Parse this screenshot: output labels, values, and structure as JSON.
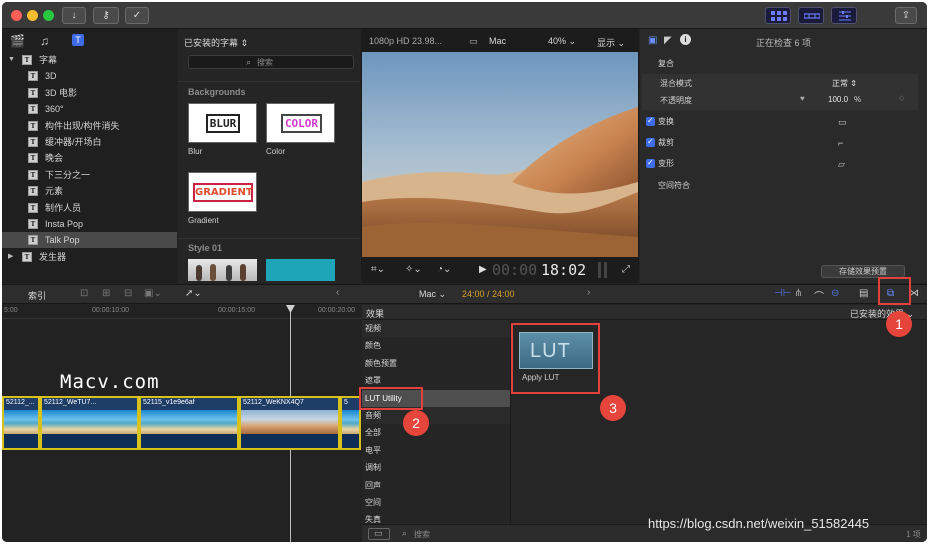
{
  "toolbar": {
    "import_icon": "download-arrow-icon",
    "keywords_icon": "key-icon",
    "analysis_icon": "checkmark-circle-icon",
    "share_icon": "share-icon"
  },
  "sidebar": {
    "items": [
      {
        "label": "字幕",
        "level": 0,
        "expanded": true
      },
      {
        "label": "3D",
        "level": 1
      },
      {
        "label": "3D 电影",
        "level": 1
      },
      {
        "label": "360°",
        "level": 1
      },
      {
        "label": "构件出现/构件消失",
        "level": 1
      },
      {
        "label": "缓冲器/开场白",
        "level": 1
      },
      {
        "label": "晚会",
        "level": 1
      },
      {
        "label": "下三分之一",
        "level": 1
      },
      {
        "label": "元素",
        "level": 1
      },
      {
        "label": "制作人员",
        "level": 1
      },
      {
        "label": "Insta Pop",
        "level": 1
      },
      {
        "label": "Talk Pop",
        "level": 1,
        "selected": true
      },
      {
        "label": "发生器",
        "level": 0,
        "expanded": false
      }
    ]
  },
  "browser": {
    "dropdown": "已安装的字幕 ⇕",
    "search_placeholder": "搜索",
    "section1": "Backgrounds",
    "thumbs": [
      {
        "text": "BLUR",
        "label": "Blur"
      },
      {
        "text": "COLOR",
        "label": "Color"
      },
      {
        "text": "GRADIENT",
        "label": "Gradient"
      }
    ],
    "section2": "Style 01"
  },
  "viewer": {
    "format": "1080p HD 23.98...",
    "project": "Mac",
    "zoom": "40% ⌄",
    "display": "显示 ⌄",
    "timecode_dim": "00:00",
    "timecode": "18:02"
  },
  "inspector": {
    "status": "正在检查 6 项",
    "composite": "复合",
    "blend_label": "混合模式",
    "blend_value": "正常 ⇕",
    "opacity_label": "不透明度",
    "opacity_value": "100.0",
    "opacity_unit": "%",
    "transform": "变换",
    "crop": "裁剪",
    "distort": "变形",
    "spatial": "空间符合",
    "save_preset": "存储效果预置"
  },
  "timeline_bar": {
    "index": "索引",
    "project": "Mac ⌄",
    "duration": "24:00 / 24:00"
  },
  "timeline": {
    "ruler": [
      "5:00",
      "00:00:10:00",
      "00:00:15:00",
      "00:00:20:00"
    ],
    "clips": [
      "52112_...",
      "52112_WeTU7...",
      "52115_v1e9e6af",
      "52112_WeKNX4Q7",
      "5"
    ]
  },
  "effects": {
    "title": "效果",
    "installed": "已安装的效果 ⌄",
    "categories": [
      {
        "label": "视频",
        "kind": "header"
      },
      {
        "label": "颜色"
      },
      {
        "label": "颜色预置"
      },
      {
        "label": "遮罩"
      },
      {
        "label": "LUT Utility",
        "selected": true
      },
      {
        "label": "音频",
        "kind": "header"
      },
      {
        "label": "全部"
      },
      {
        "label": "电平"
      },
      {
        "label": "调制"
      },
      {
        "label": "回声"
      },
      {
        "label": "空间"
      },
      {
        "label": "失真"
      }
    ],
    "effect_tile_text": "LUT",
    "effect_tile_label": "Apply LUT",
    "search_placeholder": "搜索",
    "count": "1 项"
  },
  "annotations": [
    "1",
    "2",
    "3"
  ],
  "watermarks": {
    "site": "Macv.com",
    "blog": "https://blog.csdn.net/weixin_51582445"
  },
  "colors": {
    "accent": "#3d6ce6",
    "highlight_red": "#e3413b",
    "clip_border": "#d7c11a",
    "timecode_yellow": "#d9a227"
  }
}
